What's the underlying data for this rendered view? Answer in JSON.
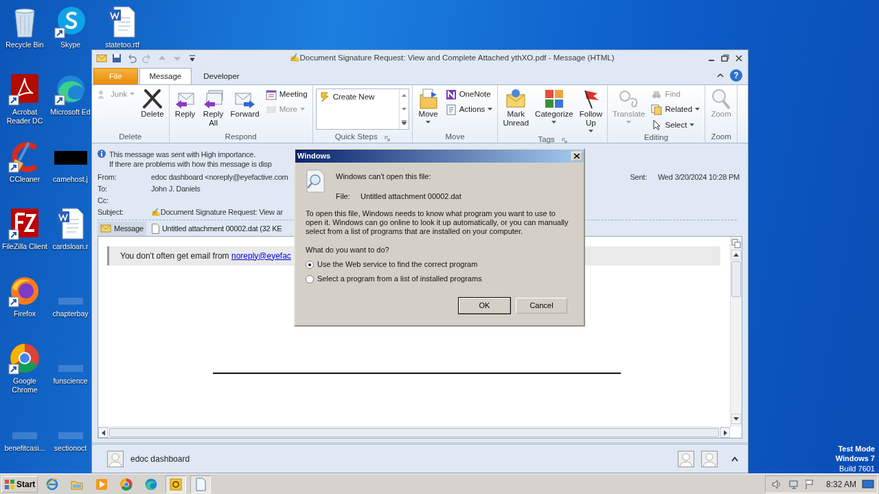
{
  "desktop": {
    "icons": [
      {
        "label": "Recycle Bin",
        "kind": "recycle",
        "shortcut": false
      },
      {
        "label": "Acrobat Reader DC",
        "kind": "pdf",
        "shortcut": true
      },
      {
        "label": "CCleaner",
        "kind": "cleaner",
        "shortcut": true
      },
      {
        "label": "FileZilla Client",
        "kind": "ftp",
        "shortcut": true
      },
      {
        "label": "Firefox",
        "kind": "firefox",
        "shortcut": true
      },
      {
        "label": "Google Chrome",
        "kind": "chrome",
        "shortcut": true
      },
      {
        "label": "benefitcasi...",
        "kind": "blank",
        "shortcut": false
      },
      {
        "label": "Skype",
        "kind": "skype",
        "shortcut": true
      },
      {
        "label": "Microsoft Ed",
        "kind": "edge",
        "shortcut": true
      },
      {
        "label": "camehost.j",
        "kind": "dark",
        "shortcut": false
      },
      {
        "label": "cardsloan.r",
        "kind": "word",
        "shortcut": false
      },
      {
        "label": "chapterbay",
        "kind": "blank",
        "shortcut": false
      },
      {
        "label": "funscience",
        "kind": "blank",
        "shortcut": false
      },
      {
        "label": "sectionoct",
        "kind": "blank",
        "shortcut": false
      },
      {
        "label": "statetoo.rtf",
        "kind": "word",
        "shortcut": false
      }
    ],
    "test_mode": [
      "Test Mode",
      "Windows 7",
      "Build 7601"
    ]
  },
  "outlook": {
    "title": "✍Document Signature Request: View and Complete Attached ythXO.pdf  -  Message (HTML)",
    "tabs": [
      {
        "label": "File",
        "kind": "file",
        "selected": false
      },
      {
        "label": "Message",
        "kind": "tab",
        "selected": true
      },
      {
        "label": "Developer",
        "kind": "tab",
        "selected": false
      }
    ],
    "help": "?",
    "ribbon": [
      {
        "label": "Delete",
        "launcher": false,
        "items": [
          {
            "label": "Junk",
            "kind": "small",
            "disabled": true,
            "dropdown": true
          },
          {
            "label": "Delete",
            "kind": "large",
            "disabled": false,
            "dropdown": false
          }
        ]
      },
      {
        "label": "Respond",
        "launcher": false,
        "items": [
          {
            "label": "Reply",
            "kind": "large",
            "disabled": false,
            "dropdown": false
          },
          {
            "label": "Reply\nAll",
            "kind": "large",
            "disabled": false,
            "dropdown": false
          },
          {
            "label": "Forward",
            "kind": "large",
            "disabled": false,
            "dropdown": false
          },
          {
            "label": "Meeting",
            "kind": "small",
            "disabled": false,
            "dropdown": false
          },
          {
            "label": "More",
            "kind": "small",
            "disabled": true,
            "dropdown": true
          }
        ]
      },
      {
        "label": "Quick Steps",
        "launcher": true,
        "items": [
          {
            "label": "Create New",
            "kind": "gallery",
            "disabled": false
          }
        ]
      },
      {
        "label": "Move",
        "launcher": false,
        "items": [
          {
            "label": "Move",
            "kind": "large",
            "disabled": false,
            "dropdown": true
          },
          {
            "label": "OneNote",
            "kind": "small",
            "disabled": false,
            "dropdown": false
          },
          {
            "label": "Actions",
            "kind": "small",
            "disabled": false,
            "dropdown": true
          }
        ]
      },
      {
        "label": "Tags",
        "launcher": true,
        "items": [
          {
            "label": "Mark\nUnread",
            "kind": "large",
            "disabled": false,
            "dropdown": false
          },
          {
            "label": "Categorize",
            "kind": "large",
            "disabled": false,
            "dropdown": true
          },
          {
            "label": "Follow\nUp",
            "kind": "large",
            "disabled": false,
            "dropdown": true
          }
        ]
      },
      {
        "label": "Editing",
        "launcher": false,
        "items": [
          {
            "label": "Translate",
            "kind": "large",
            "disabled": true,
            "dropdown": true
          },
          {
            "label": "Find",
            "kind": "small",
            "disabled": true,
            "dropdown": false
          },
          {
            "label": "Related",
            "kind": "small",
            "disabled": false,
            "dropdown": true
          },
          {
            "label": "Select",
            "kind": "small",
            "disabled": false,
            "dropdown": true
          }
        ]
      },
      {
        "label": "Zoom",
        "launcher": false,
        "items": [
          {
            "label": "Zoom",
            "kind": "large",
            "disabled": true,
            "dropdown": false
          }
        ]
      }
    ],
    "info": [
      "This message was sent with High importance.",
      "If there are problems with how this message is disp"
    ],
    "fields": [
      {
        "label": "From:",
        "value": "edoc dashboard <noreply@eyefactive.com"
      },
      {
        "label": "To:",
        "value": "John J. Daniels"
      },
      {
        "label": "Cc:"
      },
      {
        "label": "Subject:",
        "value": "✍Document Signature Request: View ar"
      }
    ],
    "sent": {
      "label": "Sent:",
      "value": "Wed 3/20/2024 10:28 PM"
    },
    "attachments": [
      {
        "label": "Message",
        "kind": "message",
        "selected": true
      },
      {
        "label": "Untitled attachment 00002.dat (32 KE",
        "kind": "file",
        "selected": false
      }
    ],
    "banner": {
      "text": "You don't often get email from ",
      "link": "noreply@eyefac"
    },
    "people": {
      "name": "edoc dashboard"
    }
  },
  "dialog": {
    "title": "Windows",
    "heading": "Windows can't open this file:",
    "file_label": "File:",
    "file_name": "Untitled attachment 00002.dat",
    "description": "To open this file, Windows needs to know what program you want to use to open it. Windows can go online to look it up automatically, or you can manually select from a list of programs that are installed on your computer.",
    "question": "What do you want to do?",
    "options": [
      {
        "label": "Use the Web service to find the correct program",
        "selected": true
      },
      {
        "label": "Select a program from a list of installed programs",
        "selected": false
      }
    ],
    "buttons": [
      {
        "label": "OK",
        "default": true
      },
      {
        "label": "Cancel",
        "default": false
      }
    ]
  },
  "taskbar": {
    "start": "Start",
    "apps": [
      {
        "kind": "ie",
        "active": false
      },
      {
        "kind": "folder",
        "active": false
      },
      {
        "kind": "media",
        "active": false
      },
      {
        "kind": "chrome",
        "active": false
      },
      {
        "kind": "edge",
        "active": false
      },
      {
        "kind": "outlook",
        "active": true
      },
      {
        "kind": "document",
        "active": true
      }
    ],
    "clock": "8:32 AM"
  }
}
